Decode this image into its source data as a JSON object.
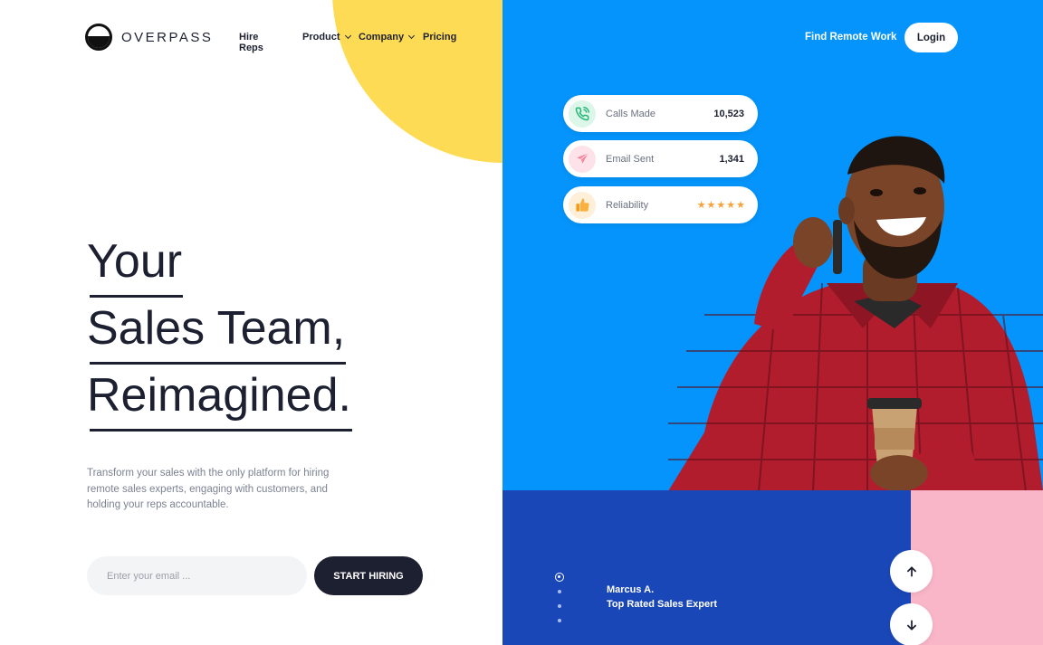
{
  "brand": {
    "name": "OVERPASS"
  },
  "nav": {
    "hire_reps": "Hire Reps",
    "product": "Product",
    "company": "Company",
    "pricing": "Pricing",
    "find_remote_work": "Find Remote Work",
    "login": "Login"
  },
  "hero": {
    "line1": "Your",
    "line2": "Sales Team,",
    "line3": "Reimagined.",
    "description": "Transform your sales with the only platform for hiring remote sales experts, engaging with customers, and holding your reps accountable.",
    "email_placeholder": "Enter your email ...",
    "cta": "START HIRING"
  },
  "stats": [
    {
      "label": "Calls Made",
      "value": "10,523",
      "icon": "phone-icon"
    },
    {
      "label": "Email Sent",
      "value": "1,341",
      "icon": "paper-plane-icon"
    },
    {
      "label": "Reliability",
      "rating": 5,
      "stars": "★★★★★",
      "icon": "thumbs-up-icon"
    }
  ],
  "testimonial": {
    "name": "Marcus A.",
    "role": "Top Rated Sales Expert",
    "slides_total": 4,
    "active_slide": 1
  },
  "colors": {
    "yellow": "#fedb55",
    "blue": "#0494fb",
    "dark_blue": "#1a47b8",
    "pink": "#f9b6c8",
    "navy": "#1d2030",
    "star": "#f8a23a"
  }
}
